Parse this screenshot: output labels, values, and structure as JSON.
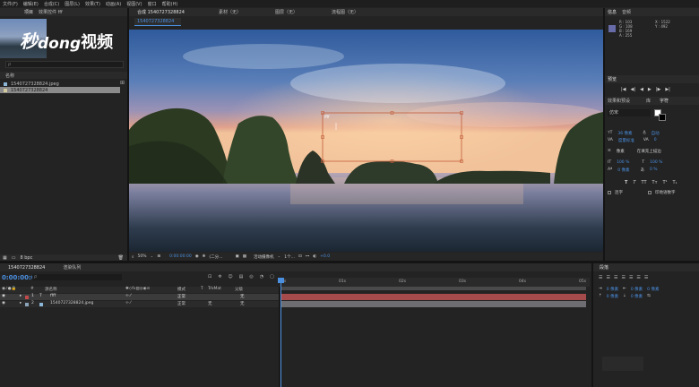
{
  "menu": [
    "文件(F)",
    "编辑(E)",
    "合成(C)",
    "图层(L)",
    "效果(T)",
    "动画(A)",
    "视图(V)",
    "窗口",
    "帮助(H)"
  ],
  "project": {
    "tab": "项目",
    "tab2": "效果控件 fff",
    "watermark_a": "秒",
    "watermark_b": "dong",
    "watermark_c": "视频",
    "search_placeholder": "ρ",
    "col_name": "名称",
    "items": [
      "1540727328824.jpeg",
      "1540727328824"
    ],
    "bpc": "8 bpc"
  },
  "viewer": {
    "tabs": [
      "合成 1540727328824",
      "素材（无）",
      "图层（无）",
      "流程图（无）"
    ],
    "sub_tab": "1540727328824",
    "text_layer_content": "ffff",
    "zoom": "50%",
    "timecode": "0:00:00:00",
    "quality": "(二分...",
    "camera": "活动摄像机",
    "views": "1个...",
    "exposure": "+0.0"
  },
  "info": {
    "tabs": [
      "信息",
      "音频"
    ],
    "values": [
      "R : 103",
      "G : 108",
      "B : 169",
      "A : 255"
    ],
    "coords": [
      "X : 1522",
      "Y : 492"
    ]
  },
  "preview": {
    "tab": "预览",
    "controls": [
      "|◀",
      "◀|",
      "◀",
      "▶",
      "|▶",
      "▶|"
    ]
  },
  "character": {
    "tabs": [
      "效果和预设",
      "库",
      "字符"
    ],
    "font": "仿宋",
    "size": "36 像素",
    "leading": "自动",
    "kerning": "度量标准",
    "tracking": "0",
    "stroke": "像素",
    "stroke_mode": "在填充上描边",
    "vscale": "100 %",
    "hscale": "100 %",
    "baseline": "0 像素",
    "tsume": "0 %",
    "styles": [
      "T",
      "T",
      "TT",
      "Tт",
      "T¹",
      "T₁"
    ],
    "ligature": "连字",
    "hindi": "印地语数字"
  },
  "paragraph": {
    "tab": "段落",
    "indent_left": "0 像素",
    "indent_right": "0 像素",
    "indent_first": "0 像素",
    "space_before": "0 像素",
    "space_after": "0 像素"
  },
  "timeline": {
    "tabs": [
      "1540727328824",
      "渲染队列"
    ],
    "timecode": "0:00:00:00",
    "search_placeholder": "ρ",
    "columns": [
      "#",
      "源名称",
      "模式",
      "T",
      "TrkMat",
      "父级"
    ],
    "layers": [
      {
        "num": "1",
        "name": "ffff",
        "mode": "正常",
        "trkmat": "",
        "parent": "无"
      },
      {
        "num": "2",
        "name": "1540727328824.jpeg",
        "mode": "正常",
        "trkmat": "无",
        "parent": "无"
      }
    ],
    "ruler": [
      "0s",
      "01s",
      "02s",
      "03s",
      "04s",
      "05s"
    ]
  }
}
